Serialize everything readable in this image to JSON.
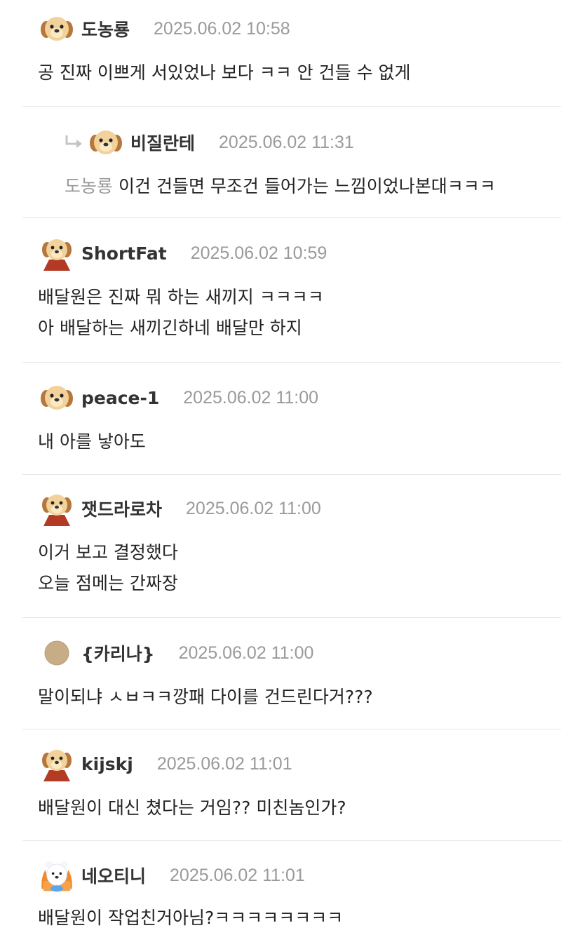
{
  "comments": [
    {
      "nick": "도농룡",
      "time": "2025.06.02 10:58",
      "avatar": "puppy-face-icon",
      "lines": [
        "공 진짜 이쁘게 서있었나 보다 ㅋㅋ 안 건들 수 없게"
      ]
    },
    {
      "nick": "비질란테",
      "time": "2025.06.02 11:31",
      "avatar": "puppy-face-icon",
      "mention": "도농룡",
      "reply": true,
      "lines": [
        "이건 건들면 무조건 들어가는 느낌이었나본대ㅋㅋㅋ"
      ]
    },
    {
      "nick": "ShortFat",
      "time": "2025.06.02 10:59",
      "avatar": "puppy-cape-icon",
      "lines": [
        "배달원은 진짜 뭐 하는 새끼지 ㅋㅋㅋㅋ",
        "아 배달하는 새끼긴하네 배달만 하지"
      ]
    },
    {
      "nick": "peace-1",
      "time": "2025.06.02 11:00",
      "avatar": "puppy-face-icon",
      "lines": [
        "내 아를 낳아도"
      ]
    },
    {
      "nick": "잿드라로차",
      "time": "2025.06.02 11:00",
      "avatar": "puppy-cape-icon",
      "lines": [
        "이거 보고 결정했다",
        "오늘 점메는 간짜장"
      ]
    },
    {
      "nick": "{카리나}",
      "time": "2025.06.02 11:00",
      "avatar": "beige-circle-icon",
      "lines": [
        "말이되냐 ㅅㅂㅋㅋ깡패 다이를 건드린다거???"
      ]
    },
    {
      "nick": "kijskj",
      "time": "2025.06.02 11:01",
      "avatar": "puppy-cape-icon",
      "lines": [
        "배달원이 대신 쳤다는 거임?? 미친놈인가?"
      ]
    },
    {
      "nick": "네오티니",
      "time": "2025.06.02 11:01",
      "avatar": "bear-fire-icon",
      "lines": [
        "배달원이 작업친거아님?ㅋㅋㅋㅋㅋㅋㅋㅋ"
      ]
    }
  ]
}
